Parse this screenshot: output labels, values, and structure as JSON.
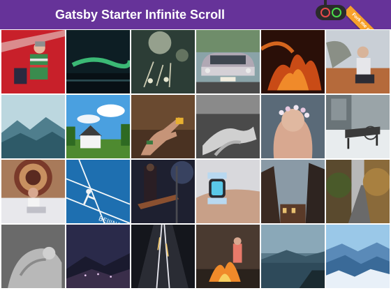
{
  "header": {
    "title": "Gatsby Starter Infinite Scroll",
    "ribbon_text": "Fork me on GitHub",
    "header_color": "#663399",
    "ribbon_color": "#f7a12b"
  },
  "grid": {
    "columns": 6,
    "images": [
      {
        "icon": "photo-woman-red-wall"
      },
      {
        "icon": "photo-aurora-night"
      },
      {
        "icon": "photo-bokeh-flowers"
      },
      {
        "icon": "photo-vintage-car"
      },
      {
        "icon": "photo-fire-flames"
      },
      {
        "icon": "photo-woman-crouching"
      },
      {
        "icon": "photo-mountain-valley"
      },
      {
        "icon": "photo-white-house"
      },
      {
        "icon": "photo-hand-holding"
      },
      {
        "icon": "photo-holding-hands"
      },
      {
        "icon": "photo-flower-crown"
      },
      {
        "icon": "photo-snowy-bench"
      },
      {
        "icon": "photo-woman-laptop-bed"
      },
      {
        "icon": "photo-tennis-court"
      },
      {
        "icon": "photo-guitarist-stage"
      },
      {
        "icon": "photo-smartwatch"
      },
      {
        "icon": "photo-dark-buildings"
      },
      {
        "icon": "photo-forest-road"
      },
      {
        "icon": "photo-feet-bw"
      },
      {
        "icon": "photo-night-city-hills"
      },
      {
        "icon": "photo-highway-night"
      },
      {
        "icon": "photo-campfire"
      },
      {
        "icon": "photo-foggy-lake"
      },
      {
        "icon": "photo-blue-mountains"
      }
    ]
  }
}
